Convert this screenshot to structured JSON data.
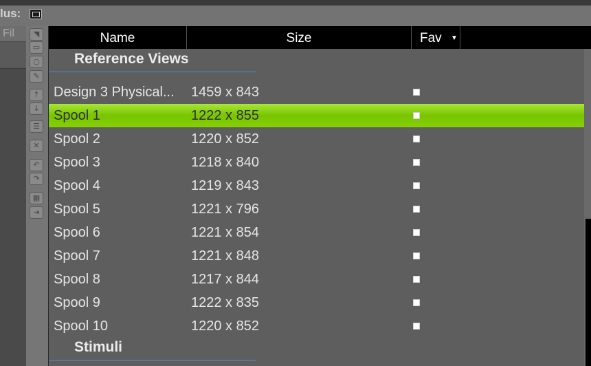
{
  "app": {
    "title_fragment": "lus:"
  },
  "left_panel": {
    "tab_label": "Fil"
  },
  "toolbar_icons": [
    "select-arrow-icon",
    "rectangle-icon",
    "ellipse-icon",
    "edit-icon",
    "move-up-icon",
    "move-down-icon",
    "layers-icon",
    "delete-icon",
    "undo-icon",
    "redo-icon",
    "grid-icon",
    "export-icon"
  ],
  "table": {
    "columns": [
      {
        "label": "Name"
      },
      {
        "label": "Size"
      },
      {
        "label": "Fav",
        "sort_icon": "sort-down-icon"
      }
    ],
    "groups": [
      {
        "title": "Reference Views",
        "rows": [
          {
            "name": "Design 3 Physical...",
            "size": "1459 x 843",
            "fav": true,
            "selected": false
          },
          {
            "name": "Spool 1",
            "size": "1222 x 855",
            "fav": true,
            "selected": true
          },
          {
            "name": "Spool 2",
            "size": "1220 x 852",
            "fav": true,
            "selected": false
          },
          {
            "name": "Spool 3",
            "size": "1218 x 840",
            "fav": true,
            "selected": false
          },
          {
            "name": "Spool 4",
            "size": "1219 x 843",
            "fav": true,
            "selected": false
          },
          {
            "name": "Spool 5",
            "size": "1221 x 796",
            "fav": true,
            "selected": false
          },
          {
            "name": "Spool 6",
            "size": "1221 x 854",
            "fav": true,
            "selected": false
          },
          {
            "name": "Spool 7",
            "size": "1221 x 848",
            "fav": true,
            "selected": false
          },
          {
            "name": "Spool 8",
            "size": "1217 x 844",
            "fav": true,
            "selected": false
          },
          {
            "name": "Spool 9",
            "size": "1222 x 835",
            "fav": true,
            "selected": false
          },
          {
            "name": "Spool 10",
            "size": "1220 x 852",
            "fav": true,
            "selected": false
          }
        ]
      },
      {
        "title": "Stimuli",
        "rows": []
      }
    ]
  },
  "colors": {
    "selection": "#84d000",
    "group_underline": "#4f8fd0",
    "header_bg": "#000000"
  }
}
